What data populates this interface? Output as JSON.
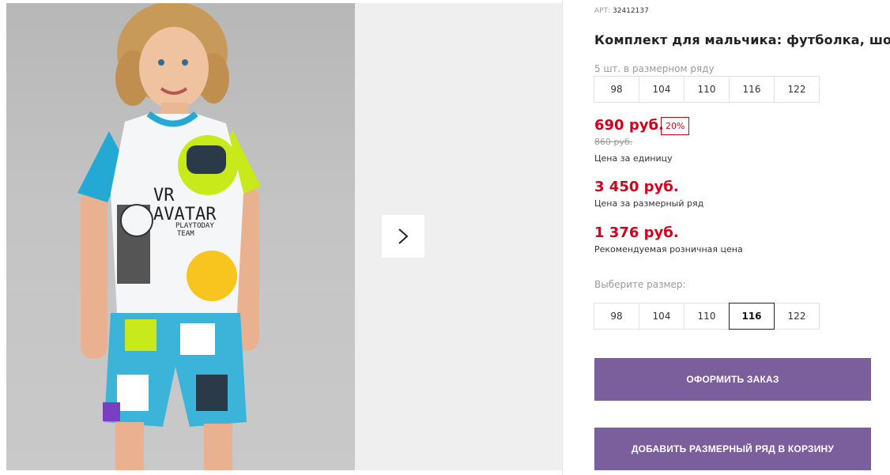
{
  "product": {
    "art_label": "АРТ:",
    "art_number": "32412137",
    "title": "Комплект для мальчика: футболка, шорты",
    "row_note": "5 шт. в размерном ряду",
    "row_sizes": [
      "98",
      "104",
      "110",
      "116",
      "122"
    ]
  },
  "pricing": {
    "unit_price": "690 руб.",
    "discount": "20%",
    "old_price": "860 руб.",
    "unit_caption": "Цена за единицу",
    "row_price": "3 450 руб.",
    "row_caption": "Цена за размерный ряд",
    "retail_price": "1 376 руб.",
    "retail_caption": "Рекомендуемая розничная цена"
  },
  "size_select": {
    "label": "Выберите размер:",
    "options": [
      "98",
      "104",
      "110",
      "116",
      "122"
    ],
    "selected": "116"
  },
  "actions": {
    "order_label": "ОФОРМИТЬ ЗАКАЗ",
    "add_row_label": "ДОБАВИТЬ РАЗМЕРНЫЙ РЯД В КОРЗИНУ"
  },
  "print": {
    "line1": "VR",
    "line2": "AVATAR",
    "line3": "PLAYTODAY",
    "line4": "TEAM"
  },
  "icons": {
    "next": "chevron-right-icon"
  },
  "colors": {
    "accent_button": "#7b5e9c",
    "price_red": "#d0021b"
  }
}
